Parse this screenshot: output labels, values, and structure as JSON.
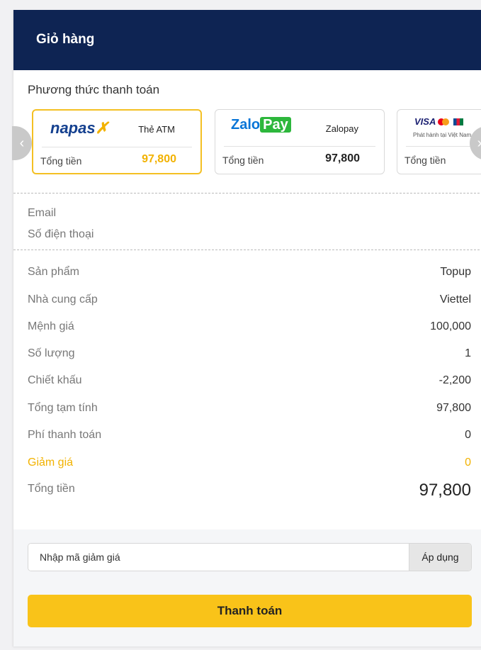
{
  "header": {
    "title": "Giỏ hàng"
  },
  "payment": {
    "title": "Phương thức thanh toán",
    "cards": [
      {
        "logo": "napas",
        "name": "Thẻ ATM",
        "total_label": "Tổng tiền",
        "total_value": "97,800",
        "selected": true
      },
      {
        "logo": "ZaloPay",
        "name": "Zalopay",
        "total_label": "Tổng tiền",
        "total_value": "97,800",
        "selected": false
      },
      {
        "logo": "VISA",
        "subtitle": "Phát hành tại Việt Nam",
        "total_label": "Tổng tiền",
        "selected": false
      }
    ]
  },
  "contact": {
    "email_label": "Email",
    "phone_label": "Số điện thoại"
  },
  "summary": {
    "rows": [
      {
        "label": "Sản phẩm",
        "value": "Topup"
      },
      {
        "label": "Nhà cung cấp",
        "value": "Viettel"
      },
      {
        "label": "Mệnh giá",
        "value": "100,000"
      },
      {
        "label": "Số lượng",
        "value": "1"
      },
      {
        "label": "Chiết khấu",
        "value": "-2,200"
      },
      {
        "label": "Tổng tạm tính",
        "value": "97,800"
      },
      {
        "label": "Phí thanh toán",
        "value": "0"
      },
      {
        "label": "Giảm giá",
        "value": "0"
      },
      {
        "label": "Tổng tiền",
        "value": "97,800"
      }
    ]
  },
  "promo": {
    "placeholder": "Nhập mã giảm giá",
    "apply_label": "Áp dụng"
  },
  "checkout": {
    "pay_label": "Thanh toán"
  },
  "colors": {
    "header_bg": "#0e2453",
    "accent": "#f9c319",
    "discount": "#f2b200"
  }
}
